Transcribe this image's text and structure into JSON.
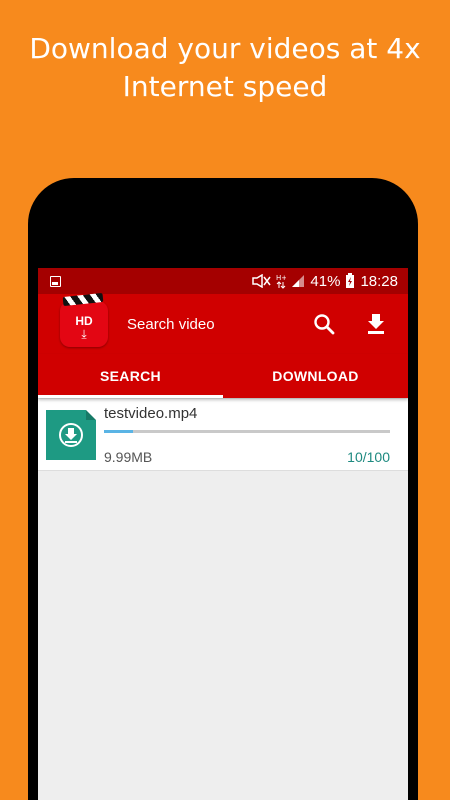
{
  "promo": {
    "line1": "Download your videos at 4x",
    "line2": "Internet speed"
  },
  "status_bar": {
    "battery": "41%",
    "time": "18:28",
    "icons": [
      "image-icon",
      "mute-icon",
      "hplus-icon",
      "signal-icon",
      "battery-charging-icon"
    ]
  },
  "app_bar": {
    "logo_text": "HD",
    "logo_arrow": "⤓",
    "title": "Search video",
    "icons": [
      "search-icon",
      "download-icon"
    ]
  },
  "tabs": [
    {
      "label": "SEARCH",
      "active": true
    },
    {
      "label": "DOWNLOAD",
      "active": false
    }
  ],
  "downloads": [
    {
      "name": "testvideo.mp4",
      "size": "9.99MB",
      "count": "10/100",
      "progress": 0.1
    }
  ],
  "colors": {
    "background": "#f78a1d",
    "status_bar": "#a40000",
    "app_bar": "#d00000",
    "file_icon": "#1e9a83",
    "progress": "#5ab4e5",
    "count_text": "#1e8a80"
  }
}
